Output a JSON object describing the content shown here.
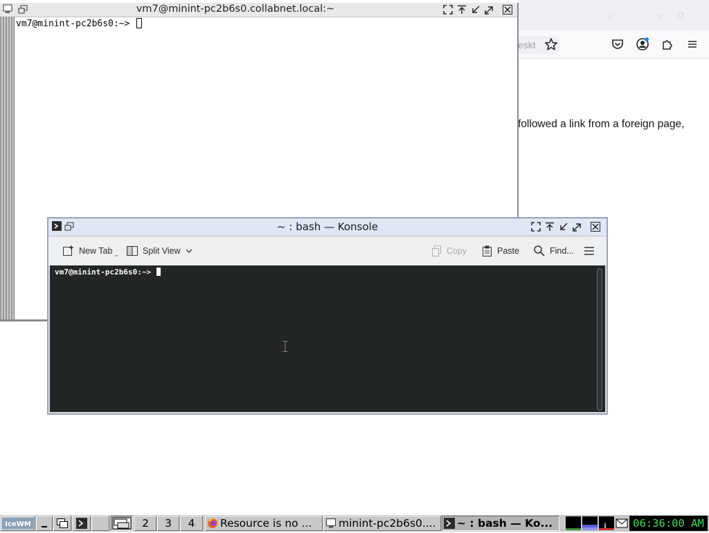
{
  "firefox": {
    "url_fragment": "eskt",
    "page_text": "followed a link from a foreign page,",
    "icons": [
      "bookmark-star-icon",
      "pocket-icon",
      "account-icon",
      "extensions-icon",
      "menu-icon"
    ]
  },
  "xterm": {
    "title": "vm7@minint-pc2b6s0.collabnet.local:~",
    "prompt": "vm7@minint-pc2b6s0:~> "
  },
  "konsole": {
    "title": "~ : bash — Konsole",
    "toolbar": {
      "new_tab": "New Tab",
      "split_view": "Split View",
      "copy": "Copy",
      "paste": "Paste",
      "find": "Find..."
    },
    "prompt": "vm7@minint-pc2b6s0:~> "
  },
  "taskbar": {
    "start_label": "IceWM",
    "desktops": [
      "1",
      "2",
      "3",
      "4"
    ],
    "active_desktop": "1",
    "tasks": [
      {
        "label": "Resource is no ...",
        "icon": "firefox-icon"
      },
      {
        "label": "minint-pc2b6s0....",
        "icon": "xterm-icon"
      },
      {
        "label": "~ : bash — Ko...",
        "icon": "konsole-icon",
        "active": true
      }
    ],
    "clock": "06:36:00 AM",
    "colors": {
      "clock_fg": "#36e05a",
      "clock_bg": "#000000"
    }
  }
}
